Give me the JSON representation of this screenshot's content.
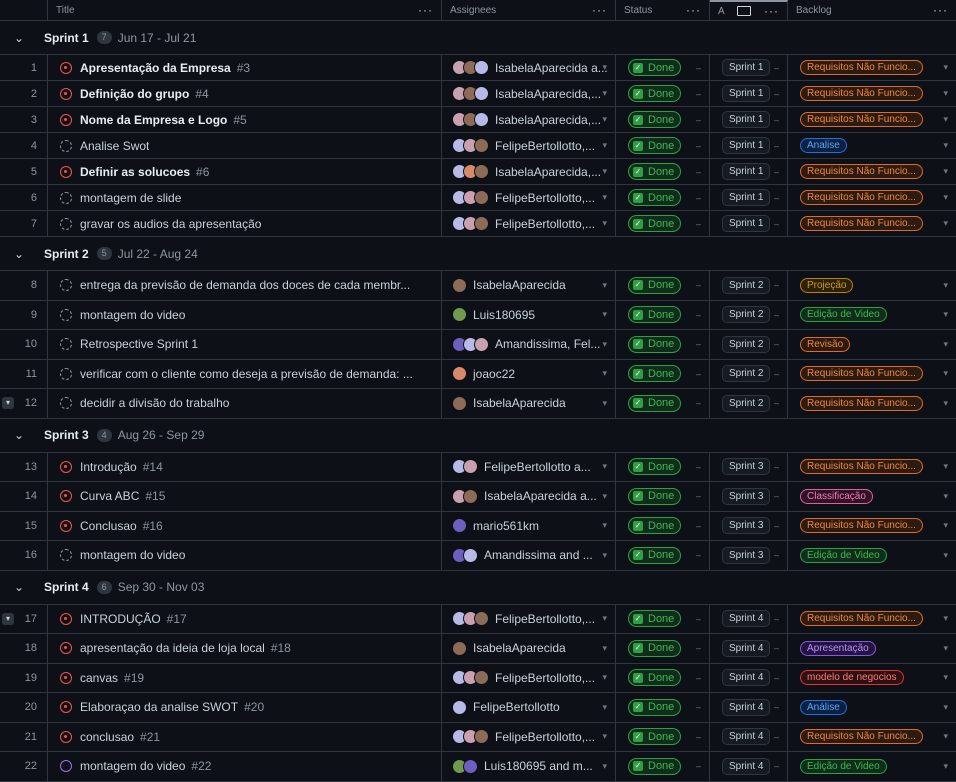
{
  "columns": {
    "title": "Title",
    "assignees": "Assignees",
    "status": "Status",
    "iteration": "A",
    "backlog": "Backlog"
  },
  "groups": [
    {
      "name": "Sprint 1",
      "count": "7",
      "dates": "Jun 17 - Jul 21",
      "rows": [
        {
          "num": "1",
          "icon": "open",
          "title": "Apresentação da Empresa",
          "issue": "#3",
          "bold": true,
          "assignees": "IsabelaAparecida a...",
          "av": [
            "a1",
            "a2",
            "a3"
          ],
          "status": "Done",
          "iter": "Sprint 1",
          "backlog": "Requisitos Não Funcio...",
          "bl": "orange"
        },
        {
          "num": "2",
          "icon": "open",
          "title": "Definição do grupo",
          "issue": "#4",
          "bold": true,
          "assignees": "IsabelaAparecida,...",
          "av": [
            "a1",
            "a2",
            "a3"
          ],
          "status": "Done",
          "iter": "Sprint 1",
          "backlog": "Requisitos Não Funcio...",
          "bl": "orange"
        },
        {
          "num": "3",
          "icon": "open",
          "title": "Nome da Empresa e Logo",
          "issue": "#5",
          "bold": true,
          "assignees": "IsabelaAparecida,...",
          "av": [
            "a1",
            "a2",
            "a3"
          ],
          "status": "Done",
          "iter": "Sprint 1",
          "backlog": "Requisitos Não Funcio...",
          "bl": "orange"
        },
        {
          "num": "4",
          "icon": "draft",
          "title": "Analise Swot",
          "issue": "",
          "bold": false,
          "assignees": "FelipeBertollotto,...",
          "av": [
            "a3",
            "a1",
            "a2"
          ],
          "status": "Done",
          "iter": "Sprint 1",
          "backlog": "Analise",
          "bl": "blue"
        },
        {
          "num": "5",
          "icon": "open",
          "title": "Definir as solucoes",
          "issue": "#6",
          "bold": true,
          "assignees": "IsabelaAparecida,...",
          "av": [
            "a3",
            "a4",
            "a2"
          ],
          "status": "Done",
          "iter": "Sprint 1",
          "backlog": "Requisitos Não Funcio...",
          "bl": "orange"
        },
        {
          "num": "6",
          "icon": "draft",
          "title": "montagem de slide",
          "issue": "",
          "bold": false,
          "assignees": "FelipeBertollotto,...",
          "av": [
            "a3",
            "a1",
            "a2"
          ],
          "status": "Done",
          "iter": "Sprint 1",
          "backlog": "Requisitos Não Funcio...",
          "bl": "orange"
        },
        {
          "num": "7",
          "icon": "draft",
          "title": "gravar os audios da apresentação",
          "issue": "",
          "bold": false,
          "assignees": "FelipeBertollotto,...",
          "av": [
            "a3",
            "a1",
            "a2"
          ],
          "status": "Done",
          "iter": "Sprint 1",
          "backlog": "Requisitos Não Funcio...",
          "bl": "orange"
        }
      ]
    },
    {
      "name": "Sprint 2",
      "count": "5",
      "dates": "Jul 22 - Aug 24",
      "rows": [
        {
          "num": "8",
          "icon": "draft",
          "title": "entrega da previsão de demanda dos doces de cada membr...",
          "issue": "",
          "bold": false,
          "assignees": "IsabelaAparecida",
          "av": [
            "a2"
          ],
          "status": "Done",
          "iter": "Sprint 2",
          "backlog": "Projeção",
          "bl": "yellow"
        },
        {
          "num": "9",
          "icon": "draft",
          "title": "montagem do video",
          "issue": "",
          "bold": false,
          "assignees": "Luis180695",
          "av": [
            "a5"
          ],
          "status": "Done",
          "iter": "Sprint 2",
          "backlog": "Edição de Video",
          "bl": "green"
        },
        {
          "num": "10",
          "icon": "draft",
          "title": "Retrospective Sprint 1",
          "issue": "",
          "bold": false,
          "assignees": "Amandissima, Fel...",
          "av": [
            "a6",
            "a3",
            "a1"
          ],
          "status": "Done",
          "iter": "Sprint 2",
          "backlog": "Revisão",
          "bl": "orange"
        },
        {
          "num": "11",
          "icon": "draft",
          "title": "verificar com o cliente como deseja a previsão de demanda: ...",
          "issue": "",
          "bold": false,
          "assignees": "joaoc22",
          "av": [
            "a4"
          ],
          "status": "Done",
          "iter": "Sprint 2",
          "backlog": "Requisitos Não Funcio...",
          "bl": "orange"
        },
        {
          "num": "12",
          "icon": "draft",
          "title": "decidir a divisão do trabalho",
          "issue": "",
          "bold": false,
          "assignees": "IsabelaAparecida",
          "av": [
            "a2"
          ],
          "status": "Done",
          "iter": "Sprint 2",
          "backlog": "Requisitos Não Funcio...",
          "bl": "orange",
          "btn": true
        }
      ]
    },
    {
      "name": "Sprint 3",
      "count": "4",
      "dates": "Aug 26 - Sep 29",
      "rows": [
        {
          "num": "13",
          "icon": "open",
          "title": "Introdução",
          "issue": "#14",
          "bold": false,
          "assignees": "FelipeBertollotto a...",
          "av": [
            "a3",
            "a1"
          ],
          "status": "Done",
          "iter": "Sprint 3",
          "backlog": "Requisitos Não Funcio...",
          "bl": "orange"
        },
        {
          "num": "14",
          "icon": "open",
          "title": "Curva ABC",
          "issue": "#15",
          "bold": false,
          "assignees": "IsabelaAparecida a...",
          "av": [
            "a1",
            "a2"
          ],
          "status": "Done",
          "iter": "Sprint 3",
          "backlog": "Classificação",
          "bl": "pink"
        },
        {
          "num": "15",
          "icon": "open",
          "title": "Conclusao",
          "issue": "#16",
          "bold": false,
          "assignees": "mario561km",
          "av": [
            "a6"
          ],
          "status": "Done",
          "iter": "Sprint 3",
          "backlog": "Requisitos Não Funcio...",
          "bl": "orange"
        },
        {
          "num": "16",
          "icon": "draft",
          "title": "montagem do video",
          "issue": "",
          "bold": false,
          "assignees": "Amandissima and ...",
          "av": [
            "a6",
            "a3"
          ],
          "status": "Done",
          "iter": "Sprint 3",
          "backlog": "Edição de Video",
          "bl": "green"
        }
      ]
    },
    {
      "name": "Sprint 4",
      "count": "6",
      "dates": "Sep 30 - Nov 03",
      "rows": [
        {
          "num": "17",
          "icon": "open",
          "title": "INTRODUÇÃO",
          "issue": "#17",
          "bold": false,
          "assignees": "FelipeBertollotto,...",
          "av": [
            "a3",
            "a1",
            "a2"
          ],
          "status": "Done",
          "iter": "Sprint 4",
          "backlog": "Requisitos Não Funcio...",
          "bl": "orange",
          "btn": true
        },
        {
          "num": "18",
          "icon": "open",
          "title": "apresentação da ideia de loja local",
          "issue": "#18",
          "bold": false,
          "assignees": "IsabelaAparecida",
          "av": [
            "a2"
          ],
          "status": "Done",
          "iter": "Sprint 4",
          "backlog": "Apresentação",
          "bl": "purple"
        },
        {
          "num": "19",
          "icon": "open",
          "title": "canvas",
          "issue": "#19",
          "bold": false,
          "assignees": "FelipeBertollotto,...",
          "av": [
            "a3",
            "a1",
            "a2"
          ],
          "status": "Done",
          "iter": "Sprint 4",
          "backlog": "modelo de negocios",
          "bl": "red"
        },
        {
          "num": "20",
          "icon": "open",
          "title": "Elaboraçao da analise SWOT",
          "issue": "#20",
          "bold": false,
          "assignees": "FelipeBertollotto",
          "av": [
            "a3"
          ],
          "status": "Done",
          "iter": "Sprint 4",
          "backlog": "Análise",
          "bl": "blue"
        },
        {
          "num": "21",
          "icon": "open",
          "title": "conclusao",
          "issue": "#21",
          "bold": false,
          "assignees": "FelipeBertollotto,...",
          "av": [
            "a3",
            "a1",
            "a2"
          ],
          "status": "Done",
          "iter": "Sprint 4",
          "backlog": "Requisitos Não Funcio...",
          "bl": "orange"
        },
        {
          "num": "22",
          "icon": "purple",
          "title": "montagem do video",
          "issue": "#22",
          "bold": false,
          "assignees": "Luis180695 and m...",
          "av": [
            "a5",
            "a6"
          ],
          "status": "Done",
          "iter": "Sprint 4",
          "backlog": "Edição de Video",
          "bl": "green"
        }
      ]
    }
  ]
}
